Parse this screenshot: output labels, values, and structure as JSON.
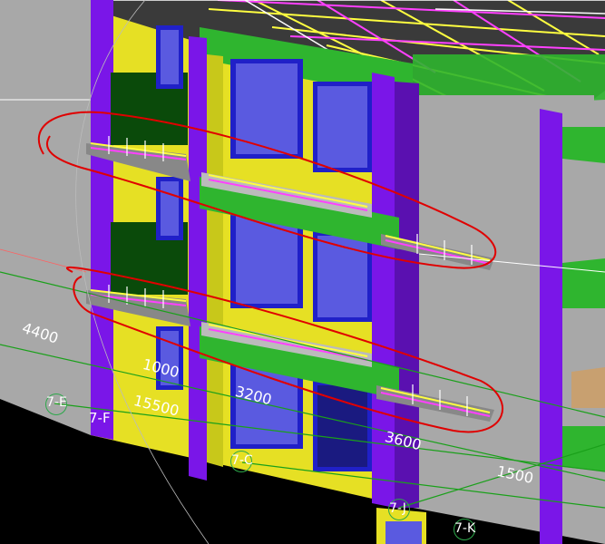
{
  "viewport": {
    "background": "#000000",
    "colors": {
      "wall": "#a8a8a8",
      "facade": "#e6e024",
      "column": "#7a16e8",
      "slab": "#2fb52f",
      "window_frame": "#2020c8",
      "glass": "#5a5ae0",
      "dark_panel": "#0a4a0a",
      "rebar_yellow": "#ffff40",
      "rebar_magenta": "#ff40ff",
      "annotation_red": "#e00000",
      "grid_line": "#1aa01a"
    }
  },
  "dimensions": {
    "d4400": "4400",
    "d1000": "1000",
    "d15500": "15500",
    "d3200": "3200",
    "d3600": "3600",
    "d1500": "1500"
  },
  "grid_axes": {
    "e": "7-E",
    "f": "7-F",
    "c": "7-C",
    "j": "7-J",
    "k": "7-K"
  }
}
